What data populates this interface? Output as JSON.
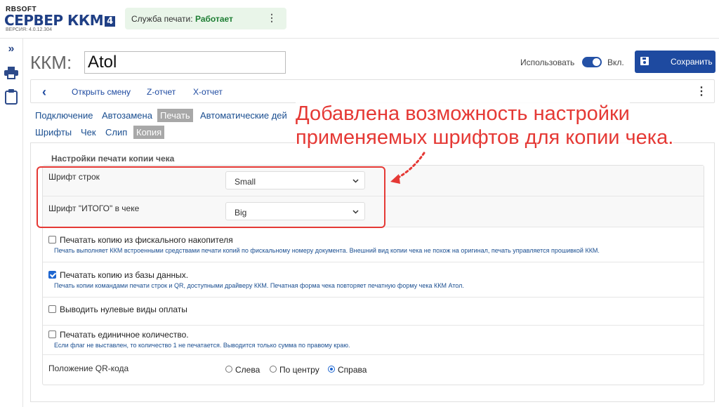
{
  "header": {
    "brand_small": "RBSOFT",
    "brand_main": "СЕРВЕР ККМ",
    "brand_badge": "4",
    "version": "ВЕРСИЯ: 4.0.12.304",
    "service_label": "Служба печати:",
    "service_status": "Работает",
    "service_status_color": "#1e7e34",
    "menu_icon": "kebab-menu-icon"
  },
  "sidebar": {
    "icons": [
      "expand-double-chevron-icon",
      "printer-icon",
      "clipboard-icon"
    ]
  },
  "device": {
    "prefix": "ККМ:",
    "name": "Atol",
    "use_label": "Использовать",
    "enabled": true,
    "on_label": "Вкл.",
    "save_label": "Сохранить",
    "accent": "#1e4aa0"
  },
  "toolbar": {
    "back_icon": "chevron-left-icon",
    "open_shift": "Открыть смену",
    "z_report": "Z-отчет",
    "x_report": "X-отчет"
  },
  "tabs": [
    {
      "label": "Подключение",
      "active": false
    },
    {
      "label": "Автозамена",
      "active": false
    },
    {
      "label": "Печать",
      "active": true
    },
    {
      "label": "Автоматические дей",
      "active": false
    }
  ],
  "subtabs": [
    {
      "label": "Шрифты",
      "active": false
    },
    {
      "label": "Чек",
      "active": false
    },
    {
      "label": "Слип",
      "active": false
    },
    {
      "label": "Копия",
      "active": true
    }
  ],
  "settings": {
    "title": "Настройки печати копии чека",
    "line_font": {
      "label": "Шрифт строк",
      "value": "Small"
    },
    "total_font": {
      "label": "Шрифт \"ИТОГО\" в чеке",
      "value": "Big"
    },
    "options": [
      {
        "label": "Печатать копию из фискального накопителя",
        "checked": false,
        "hint": "Печать выполняет ККМ встроенными средствами печати копий по фискальному номеру документа. Внешний вид копии чека не похож на оригинал, печать управляется прошивкой ККМ."
      },
      {
        "label": "Печатать копию из базы данных.",
        "checked": true,
        "hint": "Печать копии командами печати строк и QR, доступными драйверу ККМ. Печатная форма чека повторяет печатную форму чека ККМ Атол."
      },
      {
        "label": "Выводить нулевые виды оплаты",
        "checked": false,
        "hint": ""
      },
      {
        "label": "Печатать единичное количество.",
        "checked": false,
        "hint": "Если флаг не выставлен, то количество 1 не печатается. Выводится только сумма по правому краю."
      }
    ],
    "qr_position": {
      "label": "Положение QR-кода",
      "options": [
        "Слева",
        "По центру",
        "Справа"
      ],
      "selected": "Справа"
    }
  },
  "annotation": {
    "line1": "Добавлена возможность настройки",
    "line2": "применяемых шрифтов для копии чека.",
    "color": "#e53935"
  }
}
